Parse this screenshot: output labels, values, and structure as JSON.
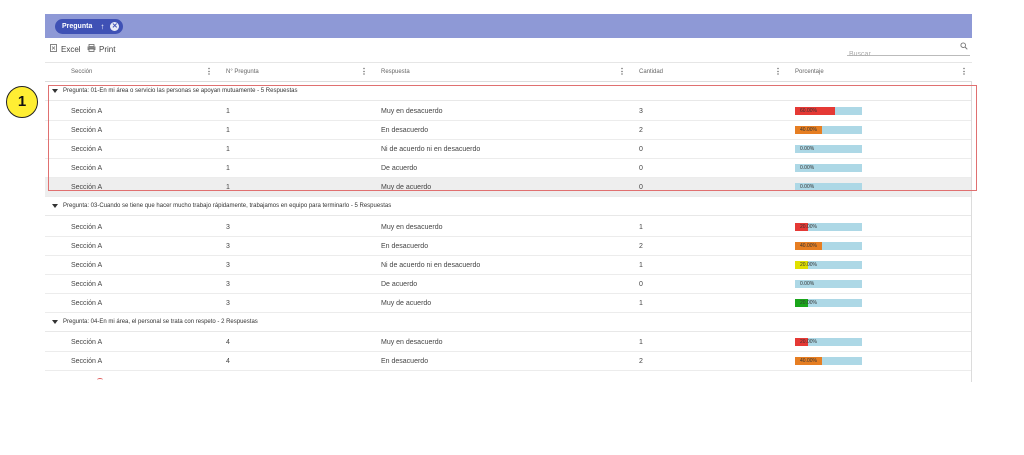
{
  "group_bar": {
    "chip_label": "Pregunta",
    "sort_glyph": "↑",
    "remove_glyph": "✕"
  },
  "toolbar": {
    "excel_label": "Excel",
    "print_label": "Print",
    "search_placeholder": "Buscar"
  },
  "columns": [
    "Sección",
    "N° Pregunta",
    "Respuesta",
    "Cantidad",
    "Porcentaje"
  ],
  "annotation": {
    "number": "1"
  },
  "groups": [
    {
      "title": "Pregunta: 01-En mi área o servicio las personas se apoyan mutuamente - 5 Respuestas",
      "rows": [
        {
          "seccion": "Sección A",
          "num": "1",
          "respuesta": "Muy en desacuerdo",
          "cantidad": "3",
          "pct_label": "60.00%",
          "pct": 60,
          "color": "#e53935"
        },
        {
          "seccion": "Sección A",
          "num": "1",
          "respuesta": "En desacuerdo",
          "cantidad": "2",
          "pct_label": "40.00%",
          "pct": 40,
          "color": "#e67e22"
        },
        {
          "seccion": "Sección A",
          "num": "1",
          "respuesta": "Ni de acuerdo ni en desacuerdo",
          "cantidad": "0",
          "pct_label": "0.00%",
          "pct": 0,
          "color": "#e0e000"
        },
        {
          "seccion": "Sección A",
          "num": "1",
          "respuesta": "De acuerdo",
          "cantidad": "0",
          "pct_label": "0.00%",
          "pct": 0,
          "color": "#4caf50"
        },
        {
          "seccion": "Sección A",
          "num": "1",
          "respuesta": "Muy de acuerdo",
          "cantidad": "0",
          "pct_label": "0.00%",
          "pct": 0,
          "color": "#1aa51a"
        }
      ]
    },
    {
      "title": "Pregunta: 03-Cuando se tiene que hacer mucho trabajo rápidamente, trabajamos en equipo para terminarlo - 5 Respuestas",
      "rows": [
        {
          "seccion": "Sección A",
          "num": "3",
          "respuesta": "Muy en desacuerdo",
          "cantidad": "1",
          "pct_label": "20.00%",
          "pct": 20,
          "color": "#e53935"
        },
        {
          "seccion": "Sección A",
          "num": "3",
          "respuesta": "En desacuerdo",
          "cantidad": "2",
          "pct_label": "40.00%",
          "pct": 40,
          "color": "#e67e22"
        },
        {
          "seccion": "Sección A",
          "num": "3",
          "respuesta": "Ni de acuerdo ni en desacuerdo",
          "cantidad": "1",
          "pct_label": "20.00%",
          "pct": 20,
          "color": "#e0e000"
        },
        {
          "seccion": "Sección A",
          "num": "3",
          "respuesta": "De acuerdo",
          "cantidad": "0",
          "pct_label": "0.00%",
          "pct": 0,
          "color": "#4caf50"
        },
        {
          "seccion": "Sección A",
          "num": "3",
          "respuesta": "Muy de acuerdo",
          "cantidad": "1",
          "pct_label": "20.00%",
          "pct": 20,
          "color": "#1aa51a"
        }
      ]
    },
    {
      "title": "Pregunta: 04-En mi área, el personal se trata con respeto - 2 Respuestas",
      "rows": [
        {
          "seccion": "Sección A",
          "num": "4",
          "respuesta": "Muy en desacuerdo",
          "cantidad": "1",
          "pct_label": "20.00%",
          "pct": 20,
          "color": "#e53935"
        },
        {
          "seccion": "Sección A",
          "num": "4",
          "respuesta": "En desacuerdo",
          "cantidad": "2",
          "pct_label": "40.00%",
          "pct": 40,
          "color": "#e67e22"
        }
      ]
    }
  ]
}
